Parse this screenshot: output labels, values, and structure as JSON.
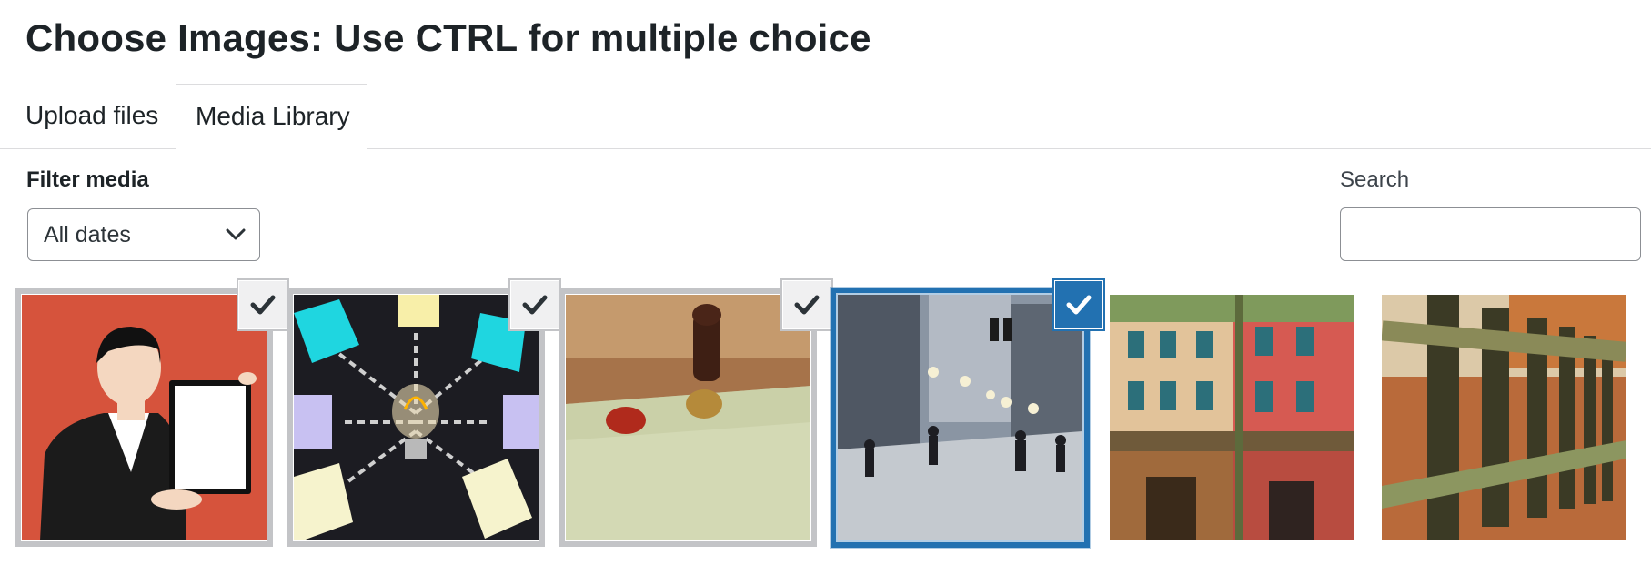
{
  "header": {
    "title": "Choose Images: Use CTRL for multiple choice"
  },
  "tabs": [
    {
      "label": "Upload files",
      "active": false
    },
    {
      "label": "Media Library",
      "active": true
    }
  ],
  "filters": {
    "label": "Filter media",
    "date_select_value": "All dates"
  },
  "search": {
    "label": "Search",
    "value": "",
    "placeholder": ""
  },
  "media": [
    {
      "subject": "woman holding blank frame",
      "state": "selected",
      "icon": "check-icon"
    },
    {
      "subject": "light bulb with sticky notes",
      "state": "selected",
      "icon": "check-icon"
    },
    {
      "subject": "wax seal stamp",
      "state": "selected",
      "icon": "check-icon"
    },
    {
      "subject": "snowy city street",
      "state": "focused",
      "icon": "check-icon"
    },
    {
      "subject": "colorful building facade",
      "state": "none"
    },
    {
      "subject": "wooden fence with autumn leaves",
      "state": "none"
    }
  ],
  "colors": {
    "accent": "#2271b1",
    "border": "#8c8f94",
    "text": "#1d2327"
  }
}
